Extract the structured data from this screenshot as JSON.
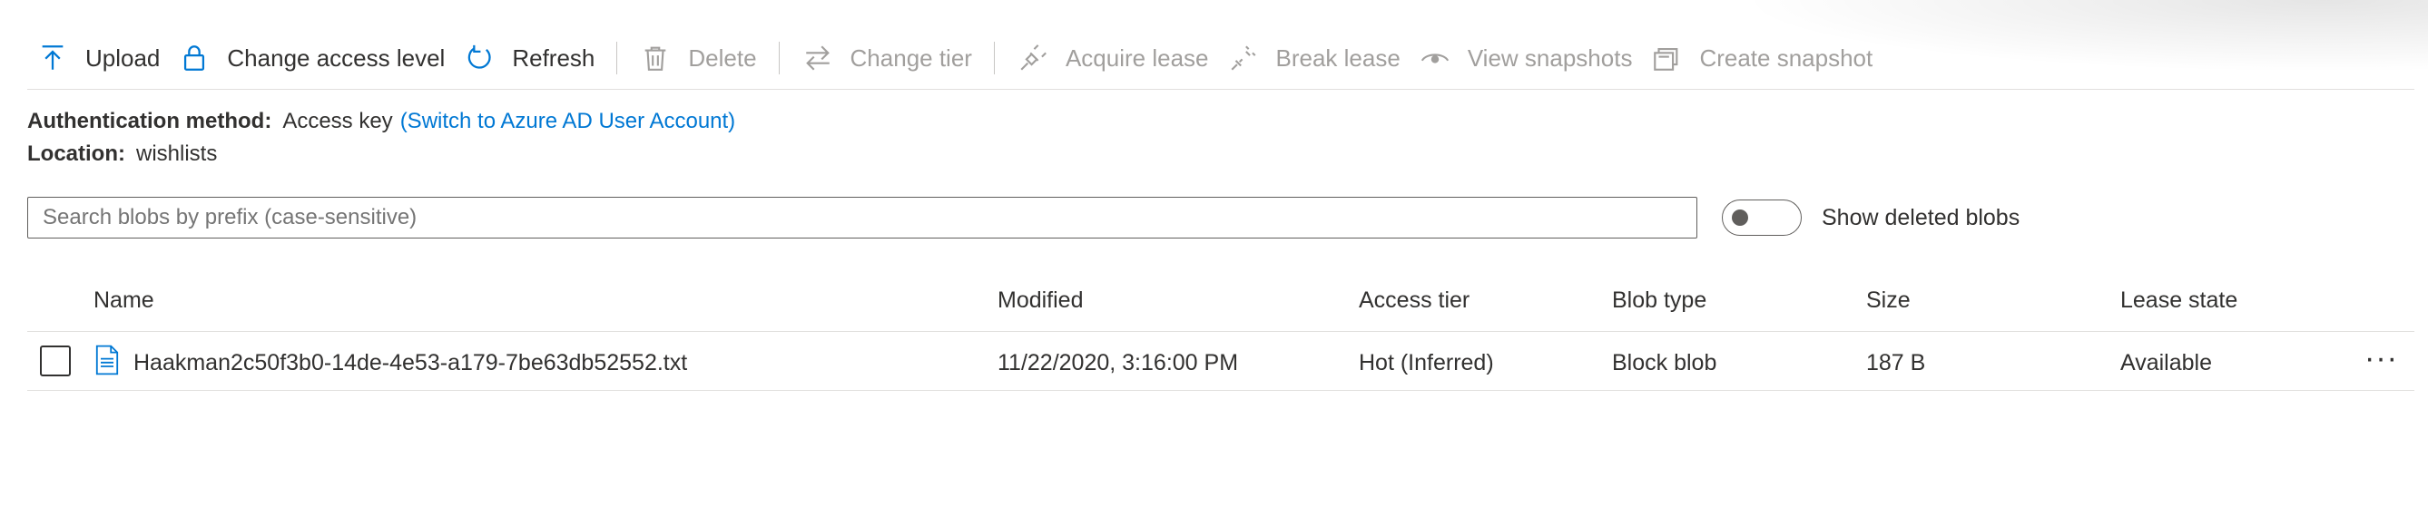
{
  "toolbar": {
    "upload": "Upload",
    "change_access": "Change access level",
    "refresh": "Refresh",
    "delete": "Delete",
    "change_tier": "Change tier",
    "acquire_lease": "Acquire lease",
    "break_lease": "Break lease",
    "view_snapshots": "View snapshots",
    "create_snapshot": "Create snapshot"
  },
  "info": {
    "auth_label": "Authentication method:",
    "auth_value": "Access key",
    "auth_switch": "(Switch to Azure AD User Account)",
    "location_label": "Location:",
    "location_value": "wishlists"
  },
  "search": {
    "placeholder": "Search blobs by prefix (case-sensitive)"
  },
  "toggle": {
    "label": "Show deleted blobs",
    "on": false
  },
  "table": {
    "headers": {
      "name": "Name",
      "modified": "Modified",
      "access_tier": "Access tier",
      "blob_type": "Blob type",
      "size": "Size",
      "lease_state": "Lease state"
    },
    "rows": [
      {
        "name": "Haakman2c50f3b0-14de-4e53-a179-7be63db52552.txt",
        "modified": "11/22/2020, 3:16:00 PM",
        "access_tier": "Hot (Inferred)",
        "blob_type": "Block blob",
        "size": "187 B",
        "lease_state": "Available",
        "more": "···"
      }
    ]
  },
  "colors": {
    "accent": "#0078d4",
    "text": "#323130",
    "disabled": "#a19f9d",
    "border": "#e1dfdd"
  },
  "icons": [
    "upload-icon",
    "lock-icon",
    "refresh-icon",
    "trash-icon",
    "swap-arrows-icon",
    "plug-icon",
    "broken-plug-icon",
    "eye-icon",
    "snapshot-stack-icon",
    "file-icon"
  ]
}
